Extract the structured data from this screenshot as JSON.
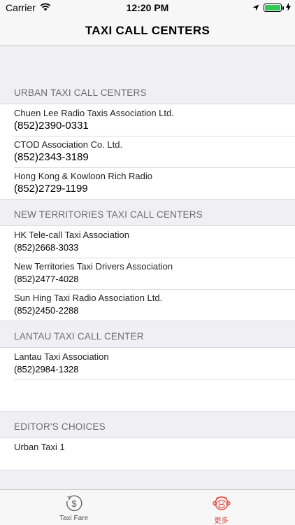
{
  "status": {
    "carrier": "Carrier",
    "time": "12:20 PM",
    "battery_level": 1.0,
    "battery_color": "#34c759"
  },
  "nav": {
    "title": "TAXI CALL CENTERS"
  },
  "sections": [
    {
      "title": "URBAN TAXI CALL CENTERS",
      "items": [
        {
          "name": "Chuen Lee Radio Taxis Association Ltd.",
          "phone": "(852)2390-0331"
        },
        {
          "name": "CTOD Association Co. Ltd.",
          "phone": "(852)2343-3189"
        },
        {
          "name": "Hong Kong & Kowloon Rich Radio",
          "phone": "(852)2729-1199"
        }
      ]
    },
    {
      "title": "NEW TERRITORIES TAXI CALL CENTERS",
      "items": [
        {
          "name": "HK Tele-call Taxi Association",
          "phone": "(852)2668-3033"
        },
        {
          "name": "New Territories Taxi Drivers Association",
          "phone": "(852)2477-4028"
        },
        {
          "name": "Sun Hing Taxi Radio Association Ltd.",
          "phone": "(852)2450-2288"
        }
      ]
    },
    {
      "title": "LANTAU TAXI CALL CENTER",
      "items": [
        {
          "name": "Lantau Taxi Association",
          "phone": "(852)2984-1328"
        }
      ]
    },
    {
      "title": "EDITOR'S CHOICES",
      "items": [
        {
          "name": "Urban Taxi 1",
          "phone": ""
        }
      ]
    }
  ],
  "tabs": [
    {
      "label": "Taxi Fare",
      "icon": "dollar-refresh-icon",
      "active": false
    },
    {
      "label": "更多",
      "icon": "monkey-face-icon",
      "active": true,
      "color": "#e8463f"
    }
  ]
}
